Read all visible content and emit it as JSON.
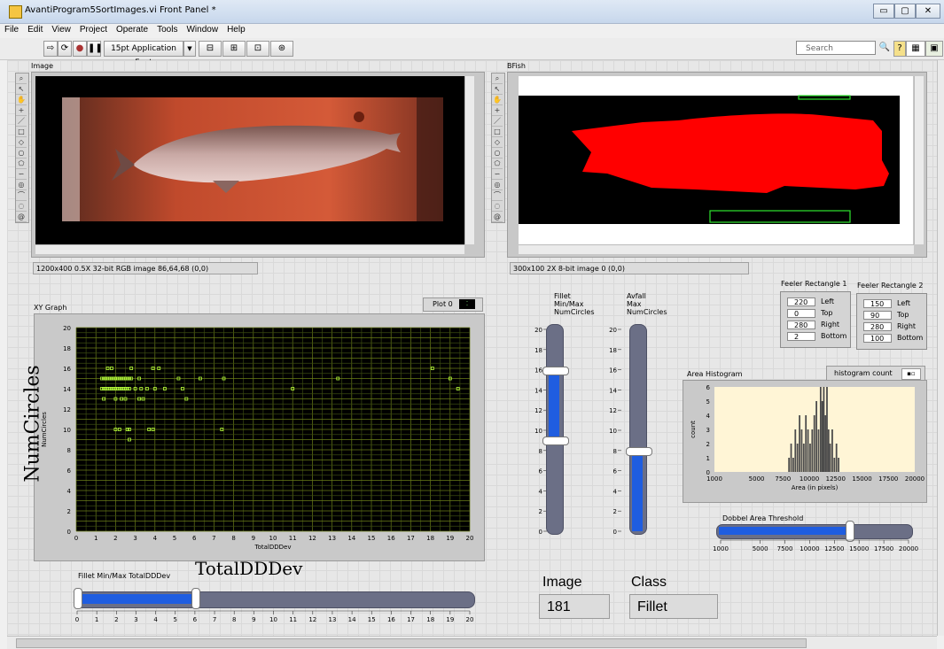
{
  "window": {
    "title": "AvantiProgram5SortImages.vi Front Panel *",
    "min": "▭",
    "max": "▢",
    "close": "✕"
  },
  "menu": [
    "File",
    "Edit",
    "View",
    "Project",
    "Operate",
    "Tools",
    "Window",
    "Help"
  ],
  "toolbar": {
    "font_label": "15pt Application Font",
    "search_placeholder": "Search"
  },
  "image_display": {
    "label": "Image",
    "info": "1200x400 0.5X 32-bit RGB image 86,64,68    (0,0)"
  },
  "bfish_display": {
    "label": "BFish",
    "info": "300x100 2X 8-bit image 0    (0,0)"
  },
  "xy_graph": {
    "label": "XY Graph",
    "plot_legend": "Plot 0",
    "big_ylabel": "NumCircles",
    "big_xlabel": "TotalDDDev"
  },
  "fillet_slider": {
    "label": "Fillet Min/Max TotalDDDev",
    "low": 0,
    "high": 6,
    "min": 0,
    "max": 20
  },
  "fillet_circles": {
    "label": "Fillet\nMin/Max\nNumCircles",
    "low": 9,
    "high": 16,
    "min": 0,
    "max": 20
  },
  "avfall_circles": {
    "label": "Avfall\nMax\nNumCircles",
    "value": 8,
    "min": 0,
    "max": 20
  },
  "feeler1": {
    "title": "Feeler Rectangle 1",
    "left": "220",
    "top": "0",
    "right": "280",
    "bottom": "2",
    "labels": [
      "Left",
      "Top",
      "Right",
      "Bottom"
    ]
  },
  "feeler2": {
    "title": "Feeler Rectangle 2",
    "left": "150",
    "top": "90",
    "right": "280",
    "bottom": "100",
    "labels": [
      "Left",
      "Top",
      "Right",
      "Bottom"
    ]
  },
  "histogram": {
    "label": "Area Histogram",
    "legend": "histogram count"
  },
  "dobbel": {
    "label": "Dobbel Area Threshold",
    "value": 14000,
    "min": 1000,
    "max": 20000,
    "ticks": [
      "1000",
      "5000",
      "7500",
      "10000",
      "12500",
      "15000",
      "17500",
      "20000"
    ]
  },
  "image_indicator": {
    "label": "Image",
    "value": "181"
  },
  "class_indicator": {
    "label": "Class",
    "value": "Fillet"
  },
  "chart_data": [
    {
      "type": "scatter",
      "title": "",
      "xlabel": "TotalDDDev",
      "ylabel": "NumCircles",
      "xlim": [
        0,
        20
      ],
      "ylim": [
        0,
        20
      ],
      "grid": true,
      "xticks": [
        "0",
        "1",
        "2",
        "3",
        "4",
        "5",
        "6",
        "7",
        "8",
        "9",
        "10",
        "11",
        "12",
        "13",
        "14",
        "15",
        "16",
        "17",
        "18",
        "19",
        "20"
      ],
      "yticks": [
        "0",
        "2",
        "4",
        "6",
        "8",
        "10",
        "12",
        "14",
        "16",
        "18",
        "20"
      ],
      "series": [
        {
          "name": "Plot 0",
          "points": [
            [
              1.6,
              16
            ],
            [
              1.8,
              16
            ],
            [
              2.8,
              16
            ],
            [
              3.9,
              16
            ],
            [
              4.2,
              16
            ],
            [
              18.1,
              16
            ],
            [
              1.3,
              15
            ],
            [
              1.4,
              15
            ],
            [
              1.5,
              15
            ],
            [
              1.6,
              15
            ],
            [
              1.7,
              15
            ],
            [
              1.8,
              15
            ],
            [
              1.9,
              15
            ],
            [
              2.0,
              15
            ],
            [
              2.1,
              15
            ],
            [
              2.2,
              15
            ],
            [
              2.3,
              15
            ],
            [
              2.4,
              15
            ],
            [
              2.5,
              15
            ],
            [
              2.6,
              15
            ],
            [
              2.7,
              15
            ],
            [
              2.8,
              15
            ],
            [
              3.2,
              15
            ],
            [
              5.2,
              15
            ],
            [
              6.3,
              15
            ],
            [
              7.5,
              15
            ],
            [
              13.3,
              15
            ],
            [
              19.0,
              15
            ],
            [
              1.3,
              14
            ],
            [
              1.4,
              14
            ],
            [
              1.5,
              14
            ],
            [
              1.6,
              14
            ],
            [
              1.7,
              14
            ],
            [
              1.8,
              14
            ],
            [
              1.9,
              14
            ],
            [
              2.0,
              14
            ],
            [
              2.1,
              14
            ],
            [
              2.2,
              14
            ],
            [
              2.3,
              14
            ],
            [
              2.4,
              14
            ],
            [
              2.5,
              14
            ],
            [
              2.6,
              14
            ],
            [
              2.7,
              14
            ],
            [
              3.0,
              14
            ],
            [
              3.3,
              14
            ],
            [
              3.6,
              14
            ],
            [
              4.0,
              14
            ],
            [
              4.5,
              14
            ],
            [
              5.4,
              14
            ],
            [
              11.0,
              14
            ],
            [
              19.4,
              14
            ],
            [
              1.4,
              13
            ],
            [
              2.0,
              13
            ],
            [
              2.3,
              13
            ],
            [
              2.5,
              13
            ],
            [
              3.2,
              13
            ],
            [
              3.4,
              13
            ],
            [
              5.6,
              13
            ],
            [
              2.0,
              10
            ],
            [
              2.2,
              10
            ],
            [
              2.6,
              10
            ],
            [
              2.7,
              10
            ],
            [
              3.7,
              10
            ],
            [
              3.9,
              10
            ],
            [
              7.4,
              10
            ],
            [
              2.7,
              9
            ]
          ]
        }
      ]
    },
    {
      "type": "bar",
      "title": "",
      "xlabel": "Area (in pixels)",
      "ylabel": "count",
      "xlim": [
        1000,
        20000
      ],
      "ylim": [
        0,
        6
      ],
      "xticks": [
        "1000",
        "5000",
        "7500",
        "10000",
        "12500",
        "15000",
        "17500",
        "20000"
      ],
      "yticks": [
        "0",
        "1",
        "2",
        "3",
        "4",
        "5",
        "6"
      ],
      "bin_width": 150,
      "bins": [
        [
          8000,
          1
        ],
        [
          8200,
          2
        ],
        [
          8400,
          1
        ],
        [
          8600,
          3
        ],
        [
          8800,
          2
        ],
        [
          9000,
          4
        ],
        [
          9200,
          3
        ],
        [
          9400,
          2
        ],
        [
          9600,
          4
        ],
        [
          9800,
          3
        ],
        [
          10000,
          2
        ],
        [
          10200,
          3
        ],
        [
          10400,
          4
        ],
        [
          10600,
          5
        ],
        [
          10800,
          3
        ],
        [
          11000,
          6
        ],
        [
          11150,
          5
        ],
        [
          11300,
          6
        ],
        [
          11450,
          4
        ],
        [
          11600,
          6
        ],
        [
          11750,
          3
        ],
        [
          11900,
          2
        ],
        [
          12100,
          3
        ],
        [
          12300,
          1
        ],
        [
          12500,
          2
        ],
        [
          12700,
          1
        ]
      ]
    }
  ]
}
